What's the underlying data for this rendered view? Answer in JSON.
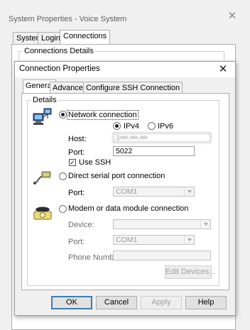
{
  "outer_window": {
    "title": "System Properties - Voice System",
    "close_glyph": "✕",
    "tabs": [
      {
        "label": "System"
      },
      {
        "label": "Login"
      },
      {
        "label": "Connections"
      }
    ],
    "group_label": "Connections Details"
  },
  "dialog": {
    "title": "Connection Properties",
    "close_glyph": "✕",
    "tabs": [
      {
        "label": "General"
      },
      {
        "label": "Advanced"
      },
      {
        "label": "Configure SSH Connection"
      }
    ],
    "details_label": "Details",
    "network": {
      "radio_label": "Network connection",
      "selected": true,
      "ipv4_label": "IPv4",
      "ipv6_label": "IPv6",
      "ip_selected": "IPv4",
      "host_label": "Host:",
      "host_value": "1•••.•••.•••",
      "port_label": "Port:",
      "port_value": "5022",
      "ssh_label": "Use SSH",
      "ssh_checked": true
    },
    "serial": {
      "radio_label": "Direct serial port connection",
      "port_label": "Port:",
      "port_value": "COM1"
    },
    "modem": {
      "radio_label": "Modem or data module connection",
      "device_label": "Device:",
      "device_value": "",
      "port_label": "Port:",
      "port_value": "COM1",
      "phone_label": "Phone Number:",
      "phone_value": "",
      "edit_devices_label": "Edit Devices..."
    },
    "buttons": {
      "ok": "OK",
      "cancel": "Cancel",
      "apply": "Apply",
      "help": "Help"
    }
  },
  "icons": {
    "network": "network-computer-icon",
    "serial": "serial-cable-icon",
    "modem": "modem-phone-icon"
  },
  "colors": {
    "window_bg": "#f0f0f0",
    "panel_bg": "#ffffff",
    "default_button_border": "#3c7fb1",
    "disabled_text": "#a0a0a0"
  }
}
